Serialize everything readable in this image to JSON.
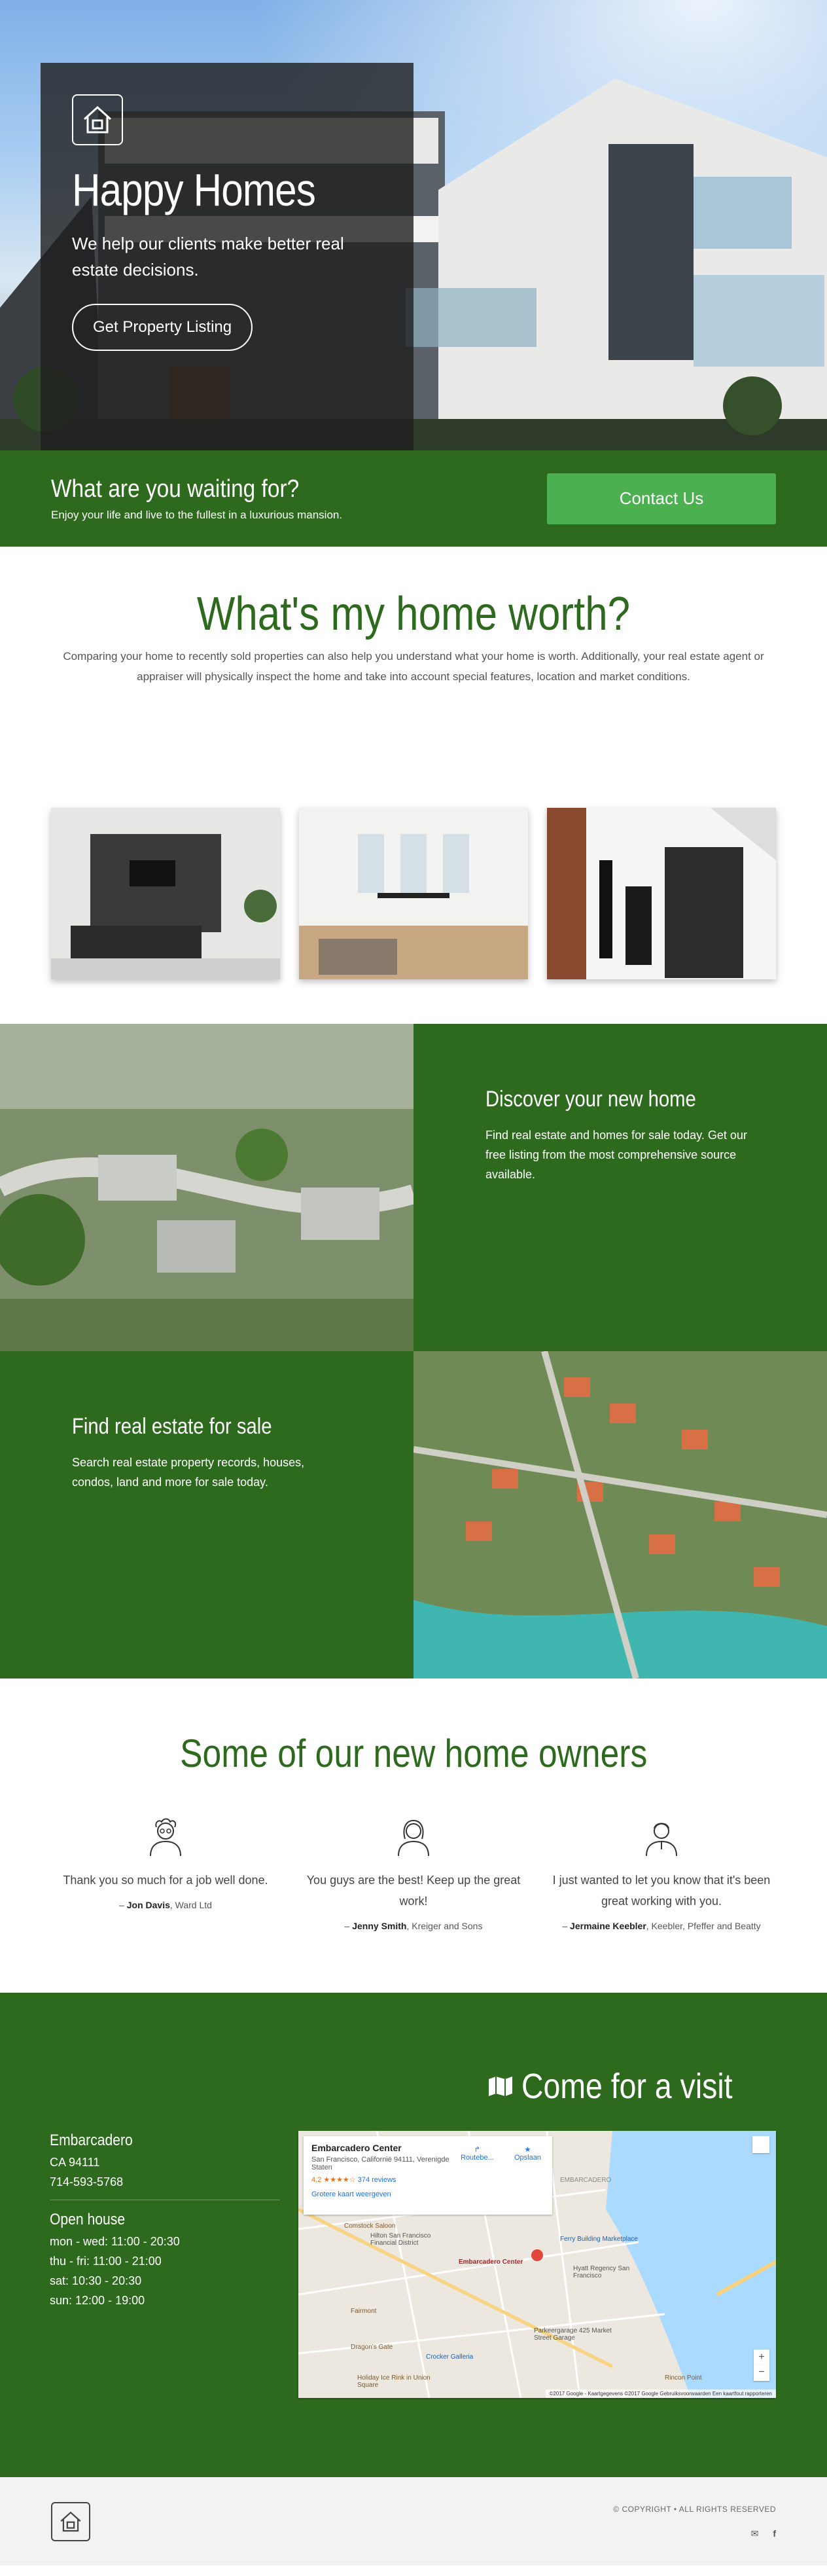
{
  "hero": {
    "title": "Happy Homes",
    "subtitle": "We help our clients make better real estate decisions.",
    "button": "Get Property Listing",
    "logo_icon": "house-icon"
  },
  "cta": {
    "title": "What are you waiting for?",
    "subtitle": "Enjoy your life and live to the fullest in a luxurious mansion.",
    "button": "Contact Us"
  },
  "worth": {
    "title": "What's my home worth?",
    "text": "Comparing your home to recently sold properties can also help you understand what your home is worth. Additionally, your real estate agent or appraiser will physically inspect the home and take into account special features, location and market conditions."
  },
  "discover": {
    "title": "Discover your new home",
    "text": "Find real estate and homes for sale today. Get our free listing from the most comprehensive source available."
  },
  "find": {
    "title": "Find real estate for sale",
    "text": "Search real estate property records, houses, condos, land and more for sale today."
  },
  "owners": {
    "title": "Some of our new home owners",
    "testimonials": [
      {
        "quote": "Thank you so much for a job well done.",
        "name": "Jon Davis",
        "company": ", Ward Ltd",
        "icon": "scientist-avatar-icon"
      },
      {
        "quote": "You guys are the best! Keep up the great work!",
        "name": "Jenny Smith",
        "company": ", Kreiger and Sons",
        "icon": "woman-avatar-icon"
      },
      {
        "quote": "I just wanted to let you know that it's been great working with you.",
        "name": "Jermaine Keebler",
        "company": ", Keebler, Pfeffer and Beatty",
        "icon": "man-avatar-icon"
      }
    ]
  },
  "visit": {
    "title": "Come for a visit",
    "location": "Embarcadero",
    "address": "CA 94111",
    "phone": "714-593-5768",
    "hours_title": "Open house",
    "hours": [
      "mon - wed: 11:00 - 20:30",
      "thu - fri: 11:00 - 21:00",
      "sat: 10:30 - 20:30",
      "sun: 12:00 - 19:00"
    ]
  },
  "map": {
    "place": "Embarcadero Center",
    "address": "San Francisco, Californië 94111, Verenigde Staten",
    "rating": "4,2 ★★★★☆",
    "reviews": "374 reviews",
    "larger": "Grotere kaart weergeven",
    "route": "Routebe...",
    "save": "Opslaan",
    "labels": [
      "Comstock Saloon",
      "Hilton San Francisco Financial District",
      "Embarcadero Center",
      "Ferry Building Marketplace",
      "Hyatt Regency San Francisco",
      "Fairmont",
      "Parkeergarage 425 Market Street Garage",
      "Dragon's Gate",
      "Crocker Galleria",
      "Holiday Ice Rink in Union Square",
      "Rincon Point",
      "EMBARCADERO"
    ],
    "attribution": "©2017 Google - Kaartgegevens ©2017 Google   Gebruiksvoorwaarden   Een kaartfout rapporteren"
  },
  "footer": {
    "copyright": "© COPYRIGHT • ALL RIGHTS RESERVED",
    "mail_icon": "mail-icon",
    "facebook_icon": "facebook-icon"
  }
}
